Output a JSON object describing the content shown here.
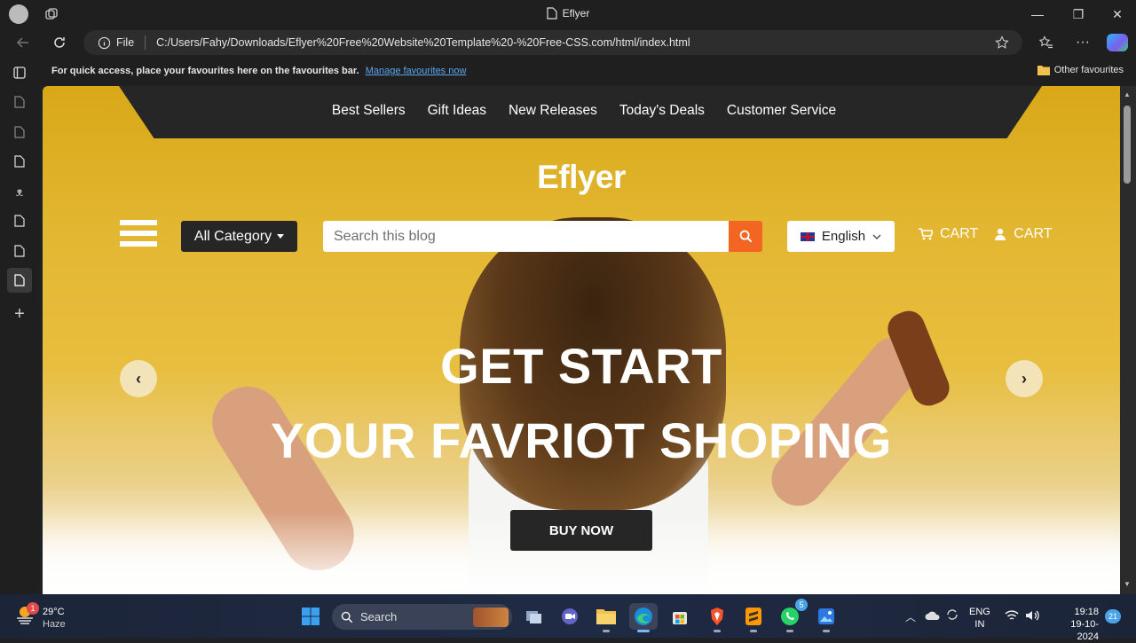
{
  "browser": {
    "title": "Eflyer",
    "url_scheme": "File",
    "url": "C:/Users/Fahy/Downloads/Eflyer%20Free%20Website%20Template%20-%20Free-CSS.com/html/index.html",
    "favourites_message": "For quick access, place your favourites here on the favourites bar.",
    "favourites_link": "Manage favourites now",
    "other_favourites": "Other favourites"
  },
  "site": {
    "nav": [
      "Best Sellers",
      "Gift Ideas",
      "New Releases",
      "Today's Deals",
      "Customer Service"
    ],
    "logo": "Eflyer",
    "all_category": "All Category",
    "search_placeholder": "Search this blog",
    "language": "English",
    "cart_1": "CART",
    "cart_2": "CART",
    "headline_1": "GET START",
    "headline_2": "YOUR FAVRIOT SHOPING",
    "buy_now": "BUY NOW"
  },
  "taskbar": {
    "weather_temp": "29°C",
    "weather_desc": "Haze",
    "weather_badge": "1",
    "search": "Search",
    "whatsapp_badge": "5",
    "lang_1": "ENG",
    "lang_2": "IN",
    "time": "19:18",
    "date": "19-10-2024",
    "notif_count": "21"
  }
}
